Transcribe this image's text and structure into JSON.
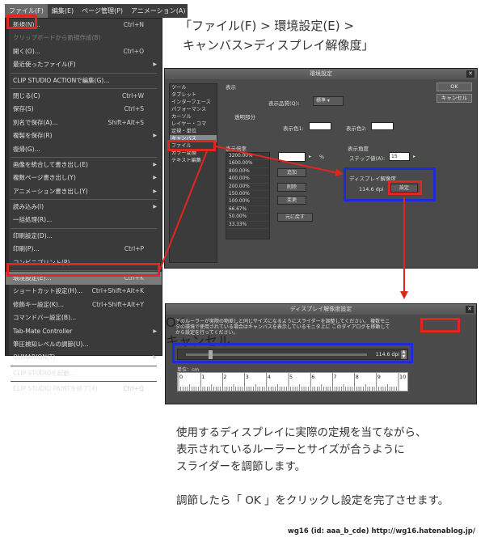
{
  "menubar": {
    "items": [
      "ファイル(F)",
      "編集(E)",
      "ページ管理(P)",
      "アニメーション(A)"
    ]
  },
  "file_menu": {
    "items": [
      {
        "label": "新規(N)...",
        "shortcut": "Ctrl+N",
        "disabled": false
      },
      {
        "label": "クリップボードから新規作成(B)",
        "shortcut": "",
        "disabled": true
      },
      {
        "label": "開く(O)...",
        "shortcut": "Ctrl+O",
        "disabled": false
      },
      {
        "label": "最近使ったファイル(F)",
        "shortcut": "",
        "submenu": true
      },
      {
        "sep": true
      },
      {
        "label": "CLIP STUDIO ACTIONで編集(G)...",
        "shortcut": ""
      },
      {
        "sep": true
      },
      {
        "label": "閉じる(C)",
        "shortcut": "Ctrl+W"
      },
      {
        "label": "保存(S)",
        "shortcut": "Ctrl+S"
      },
      {
        "label": "別名で保存(A)...",
        "shortcut": "Shift+Alt+S"
      },
      {
        "label": "複製を保存(R)",
        "shortcut": "",
        "submenu": true
      },
      {
        "label": "復帰(G)...",
        "shortcut": ""
      },
      {
        "sep": true
      },
      {
        "label": "画像を統合して書き出し(E)",
        "shortcut": "",
        "submenu": true
      },
      {
        "label": "複数ページ書き出し(Y)",
        "shortcut": "",
        "submenu": true
      },
      {
        "label": "アニメーション書き出し(Y)",
        "shortcut": "",
        "submenu": true
      },
      {
        "sep": true
      },
      {
        "label": "読み込み(I)",
        "shortcut": "",
        "submenu": true
      },
      {
        "label": "一括処理(R)...",
        "shortcut": ""
      },
      {
        "sep": true
      },
      {
        "label": "印刷設定(D)...",
        "shortcut": ""
      },
      {
        "label": "印刷(P)...",
        "shortcut": "Ctrl+P"
      },
      {
        "label": "コンビニプリント(P)...",
        "shortcut": ""
      },
      {
        "sep": true
      },
      {
        "label": "環境設定(E)...",
        "shortcut": "Ctrl+K",
        "highlight": true
      },
      {
        "label": "ショートカット設定(H)...",
        "shortcut": "Ctrl+Shift+Alt+K"
      },
      {
        "label": "修飾キー設定(K)...",
        "shortcut": "Ctrl+Shift+Alt+Y"
      },
      {
        "label": "コマンドバー設定(B)...",
        "shortcut": ""
      },
      {
        "label": "Tab-Mate Controller",
        "shortcut": "",
        "submenu": true
      },
      {
        "label": "筆圧検知レベルの調節(U)...",
        "shortcut": ""
      },
      {
        "label": "QUMARION(T)",
        "shortcut": "",
        "submenu": true
      },
      {
        "sep": true
      },
      {
        "label": "CLIP STUDIOを起動...",
        "shortcut": ""
      },
      {
        "sep": true
      },
      {
        "label": "CLIP STUDIO PAINTを終了(X)",
        "shortcut": "Ctrl+Q"
      }
    ]
  },
  "caption": {
    "line1": "「ファイル(F) > 環境設定(E) >",
    "line2": "キャンバス>ディスプレイ解像度」"
  },
  "env_dialog": {
    "title": "環境設定",
    "categories": [
      "ツール",
      "タブレット",
      "インターフェース",
      "パフォーマンス",
      "カーソル",
      "レイヤー・コマ",
      "定規・単位",
      "キャンバス",
      "ファイル",
      "カラー変換",
      "テキスト編集"
    ],
    "selected_category": "キャンバス",
    "ok_label": "OK",
    "cancel_label": "キャンセル",
    "display_label": "表示",
    "quality_label": "表示品質(Q):",
    "quality_value": "標準",
    "transparent_label": "透明部分",
    "color1_label": "表示色1:",
    "color2_label": "表示色2:",
    "zoom_label": "表示倍率",
    "zoom_values": [
      "3200.00%",
      "1600.00%",
      "800.00%",
      "400.00%",
      "200.00%",
      "150.00%",
      "100.00%",
      "66.67%",
      "50.00%",
      "33.33%"
    ],
    "zoom_unit": "%",
    "add_label": "追加",
    "delete_label": "削除",
    "change_label": "変更",
    "reset_label": "元に戻す",
    "angle_label": "表示角度",
    "step_label": "ステップ値(A):",
    "step_value": "15",
    "resolution_label": "ディスプレイ解像度",
    "resolution_value": "114.6 dpi",
    "settings_label": "設定"
  },
  "res_dialog": {
    "title": "ディスプレイ解像度設定",
    "desc": "下のルーラーが実際の物差しと同じサイズになるようにスライダーを調整してください。 複数モニタの環境で使用されている場合はキャンバスを表示しているモニタ上に このダイアログを移動してから設定を行ってください。",
    "ok_label": "OK",
    "cancel_label": "キャンセル",
    "slider_value": "114.6 dpi",
    "unit_label": "単位：cm",
    "ruler_numbers": [
      "0",
      "1",
      "2",
      "3",
      "4",
      "5",
      "6",
      "7",
      "8",
      "9",
      "10"
    ]
  },
  "instructions": {
    "p1": "使用するディスプレイに実際の定規を当てながら、",
    "p2": "表示されているルーラーとサイズが合うように",
    "p3": "スライダーを調節します。",
    "p4": "調節したら「 OK 」をクリックし設定を完了させます。"
  },
  "credit": "wg16 (id: aaa_b_cde) http://wg16.hatenablog.jp/",
  "colors": {
    "highlight_red": "#e0261f",
    "highlight_blue": "#1e2bd9"
  }
}
